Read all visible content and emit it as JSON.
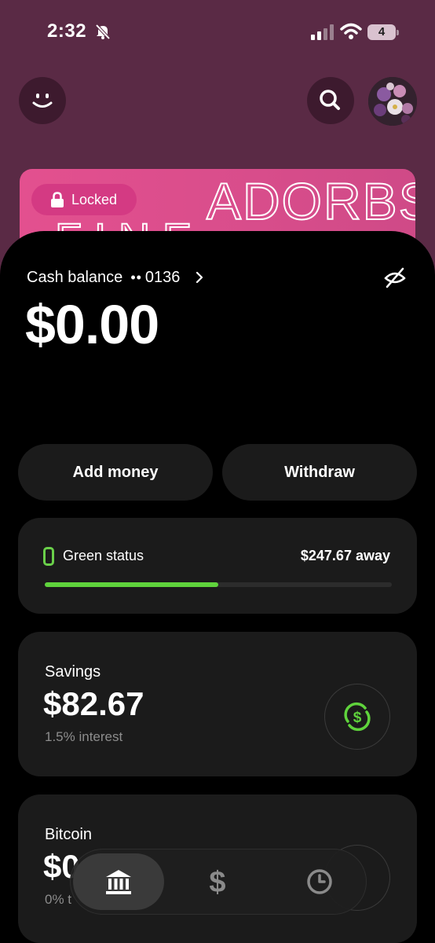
{
  "status_bar": {
    "time": "2:32",
    "battery_level": "4"
  },
  "card": {
    "locked_label": "Locked",
    "card_text": "ADORBS"
  },
  "cash": {
    "label": "Cash balance",
    "masked_dots": "••",
    "account_last4": "0136",
    "balance": "$0.00"
  },
  "actions": {
    "add_money": "Add money",
    "withdraw": "Withdraw"
  },
  "green_status": {
    "label": "Green status",
    "away": "$247.67 away",
    "progress": 0.5
  },
  "savings": {
    "title": "Savings",
    "amount": "$82.67",
    "interest": "1.5% interest"
  },
  "bitcoin": {
    "title": "Bitcoin",
    "amount": "$0",
    "sub": "0% t"
  },
  "colors": {
    "accent_green": "#5fd33c",
    "card_pink": "#e3508f",
    "background": "#5a2a45"
  },
  "nav": {
    "items": [
      "home-icon",
      "dollar-icon",
      "clock-icon"
    ],
    "active": "home-icon"
  }
}
